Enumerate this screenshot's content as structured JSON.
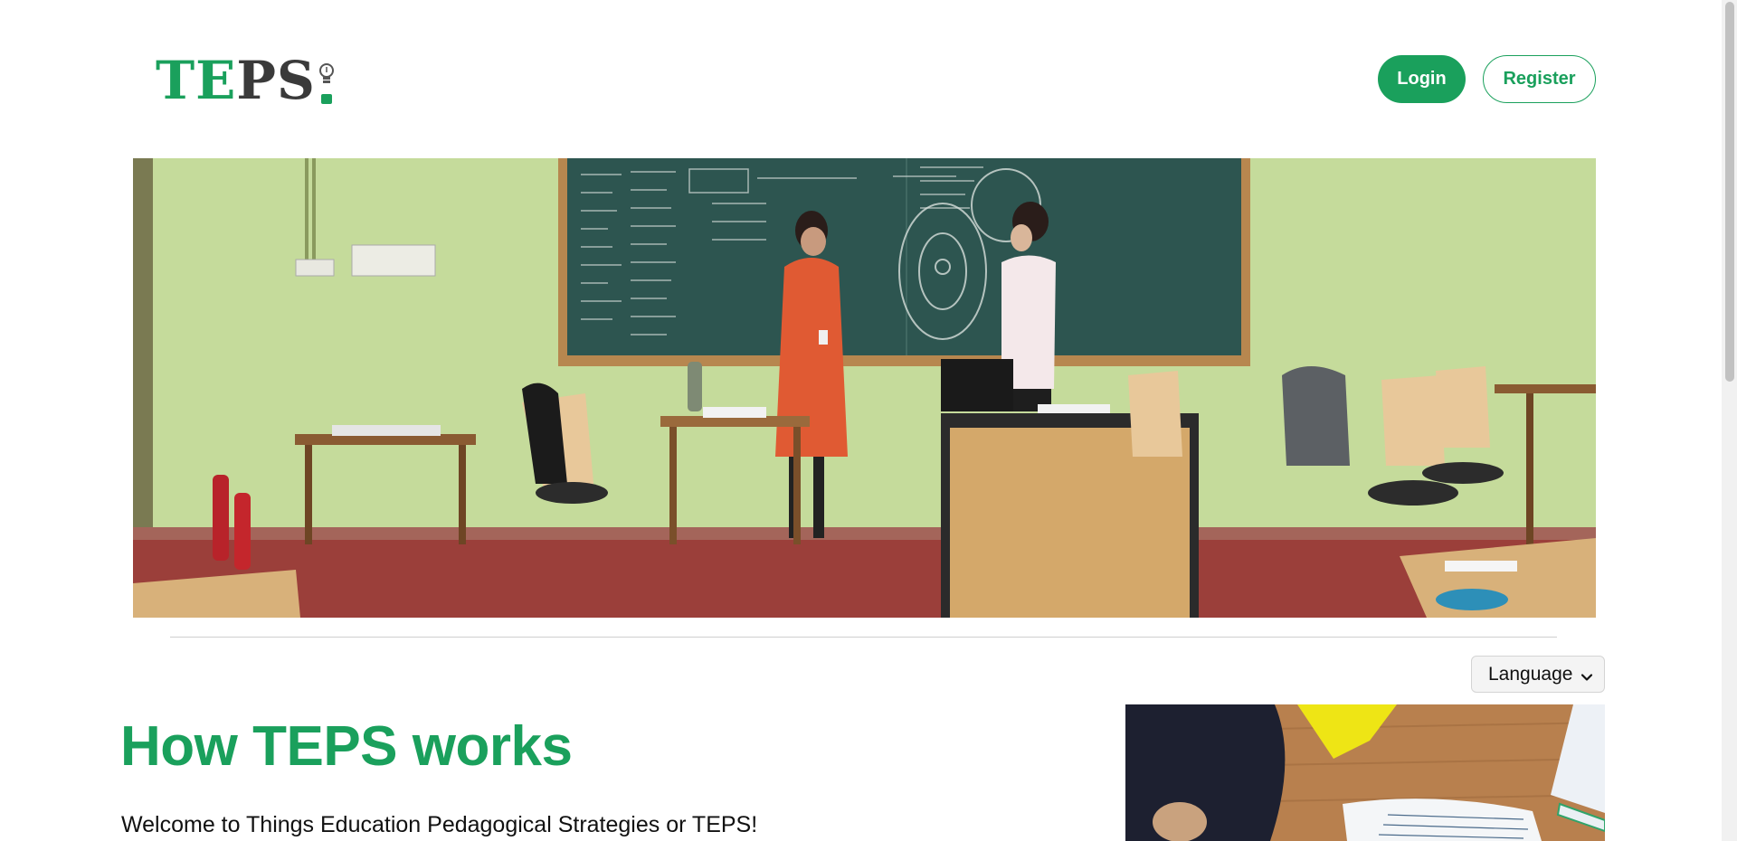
{
  "header": {
    "logo": {
      "part1": "TE",
      "part2": "PS",
      "icon": "lightbulb-icon"
    },
    "login_label": "Login",
    "register_label": "Register"
  },
  "hero": {
    "image": "classroom-training-photo"
  },
  "language_select": {
    "selected": "Language",
    "icon": "chevron-down-icon"
  },
  "main": {
    "title": "How TEPS works",
    "intro": "Welcome to Things Education Pedagogical Strategies or TEPS!"
  },
  "side_image": {
    "image": "worksheet-activity-photo"
  },
  "colors": {
    "brand_green": "#1aa05c",
    "logo_dark": "#3a3a3a"
  }
}
